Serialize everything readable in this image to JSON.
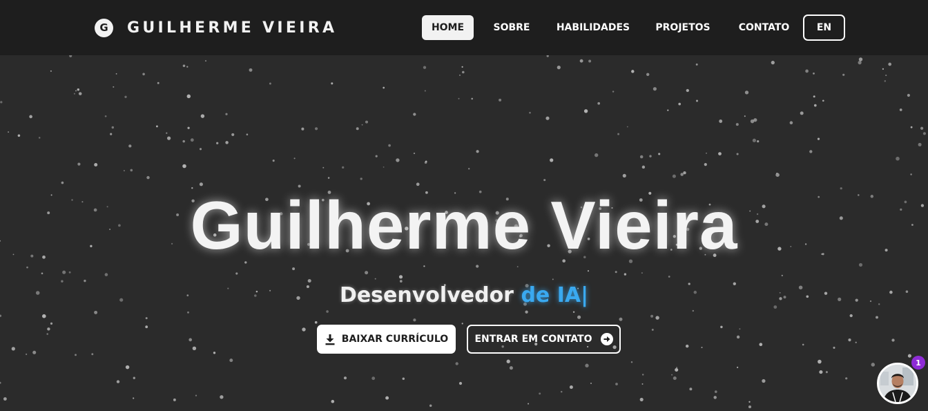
{
  "navbar": {
    "logo_letter": "G",
    "brand": "GUILHERME VIEIRA",
    "items": [
      {
        "label": "HOME",
        "active": true
      },
      {
        "label": "SOBRE"
      },
      {
        "label": "HABILIDADES"
      },
      {
        "label": "PROJETOS"
      },
      {
        "label": "CONTATO"
      }
    ],
    "language": "EN"
  },
  "hero": {
    "name": "Guilherme Vieira",
    "role_prefix": "Desenvolvedor",
    "role_typed": "de IA|",
    "buttons": {
      "download_cv": {
        "label": "BAIXAR CURRÍCULO",
        "icon": "download-icon"
      },
      "contact": {
        "label": "ENTRAR EM CONTATO",
        "icon": "arrow-right-circle-icon"
      }
    }
  },
  "chat_widget": {
    "avatar": "profile-photo",
    "notification_count": "1"
  },
  "colors": {
    "navbar_bg": "#1e1e1e",
    "hero_bg": "#2b2b2b",
    "accent": "#3aa9f0",
    "badge": "#8e2bd6"
  }
}
